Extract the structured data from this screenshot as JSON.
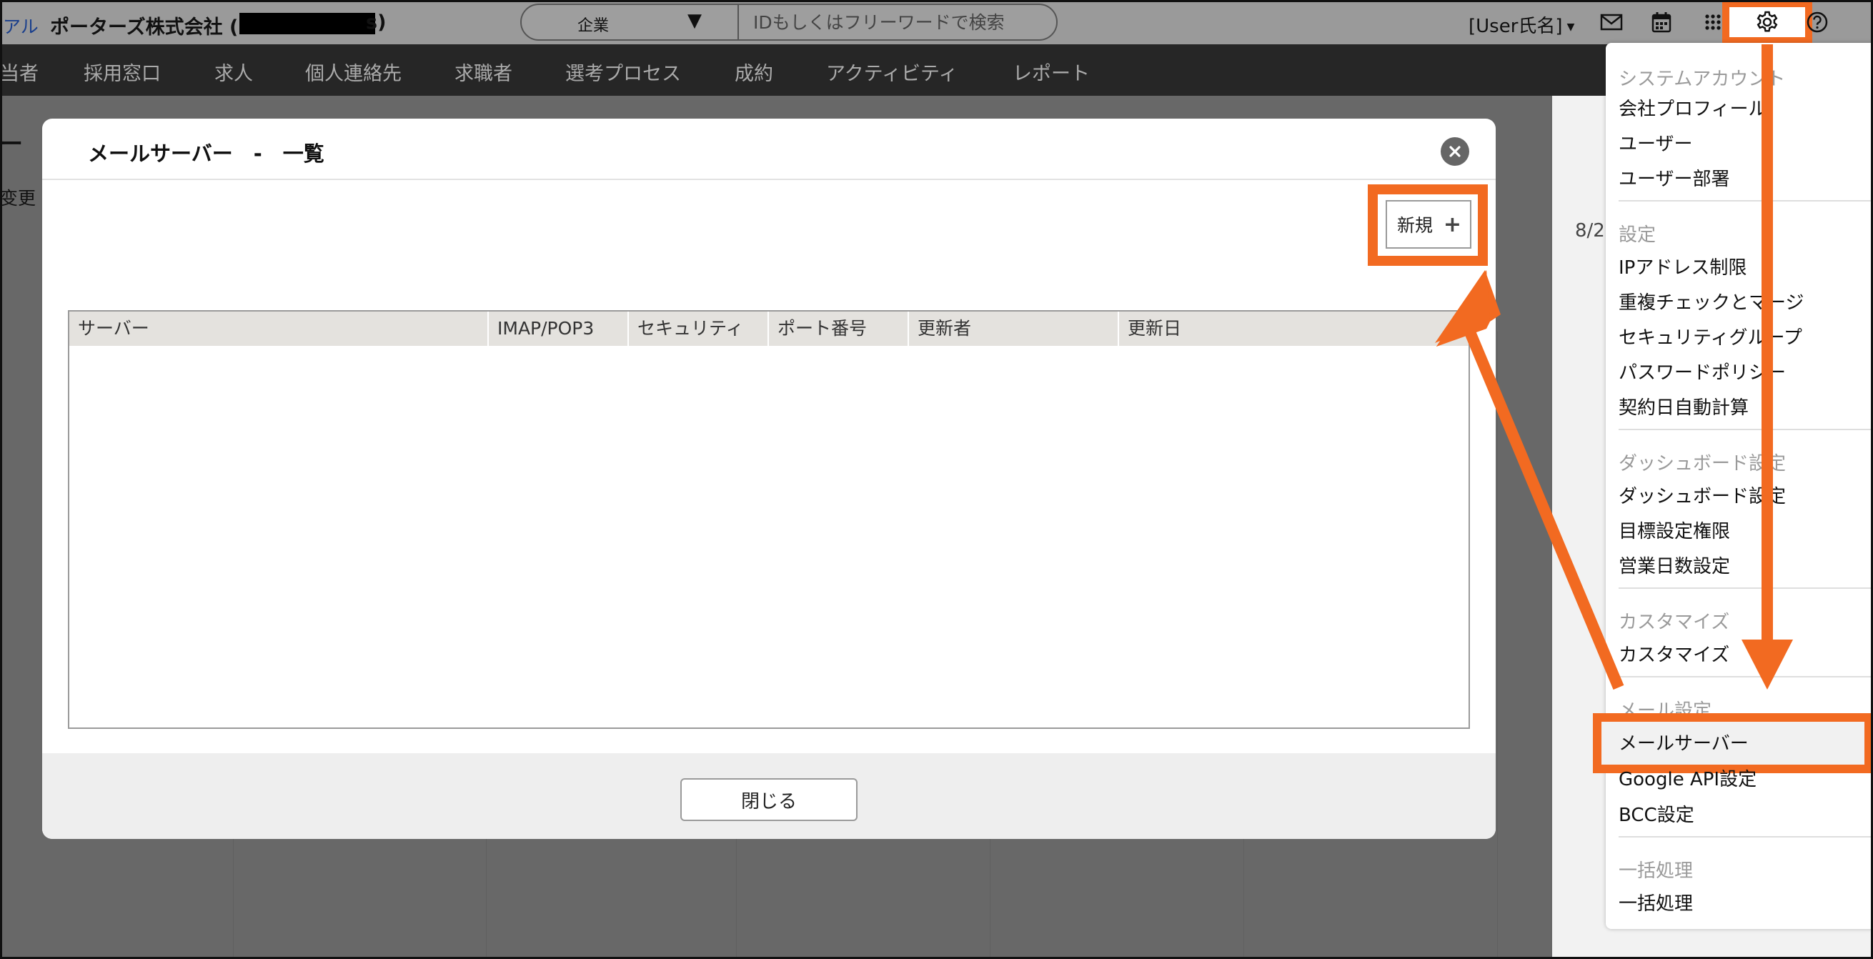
{
  "header": {
    "manual_link": "アル",
    "company_name": "ポーターズ株式会社 (",
    "company_tail": "s)",
    "entity_select": "企業",
    "search_placeholder": "IDもしくはフリーワードで検索",
    "user_name": "[User氏名]"
  },
  "nav": {
    "items": [
      "当者",
      "採用窓口",
      "求人",
      "個人連絡先",
      "求職者",
      "選考プロセス",
      "成約",
      "アクティビティ",
      "レポート"
    ]
  },
  "background": {
    "title_fragment": "ー",
    "change_fragment": "变更",
    "date_fragment": "8/2"
  },
  "modal": {
    "title": "メールサーバー　-　一覧",
    "new_button": "新規",
    "new_button_plus": "+",
    "columns": [
      "サーバー",
      "IMAP/POP3",
      "セキュリティ",
      "ポート番号",
      "更新者",
      "更新日"
    ],
    "rows": [],
    "close_button": "閉じる"
  },
  "settings_menu": {
    "sections": [
      {
        "title": "システムアカウント",
        "items": [
          "会社プロフィール",
          "ユーザー",
          "ユーザー部署"
        ]
      },
      {
        "title": "設定",
        "items": [
          "IPアドレス制限",
          "重複チェックとマージ",
          "セキュリティグループ",
          "パスワードポリシー",
          "契約日自動計算"
        ]
      },
      {
        "title": "ダッシュボード設定",
        "items": [
          "ダッシュボード設定",
          "目標設定権限",
          "営業日数設定"
        ]
      },
      {
        "title": "カスタマイズ",
        "items": [
          "カスタマイズ"
        ]
      },
      {
        "title": "メール設定",
        "items": [
          "メールサーバー",
          "Google API設定",
          "BCC設定"
        ]
      },
      {
        "title": "一括処理",
        "items": [
          "一括処理"
        ]
      }
    ],
    "highlighted_item": "メールサーバー"
  },
  "colors": {
    "annotation": "#f26a21",
    "nav_background": "#262626",
    "overlay": "#6b6b6b"
  }
}
